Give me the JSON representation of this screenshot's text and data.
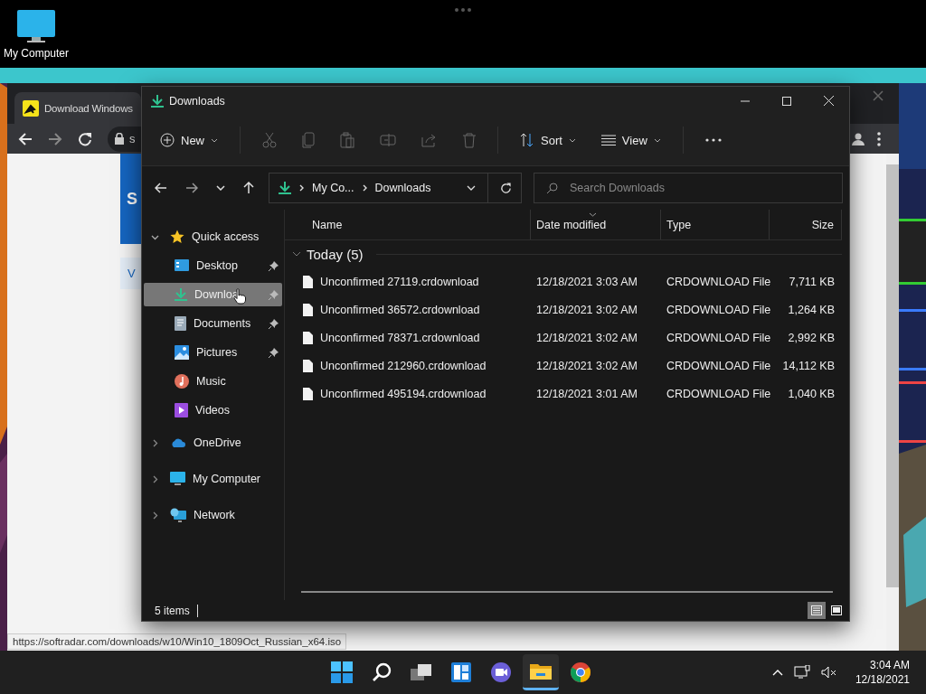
{
  "desktop": {
    "icons": [
      {
        "label": "My Computer"
      }
    ]
  },
  "browser": {
    "tab_title": "Download Windows",
    "address_text": "s",
    "page_fragments": [
      "S",
      "V"
    ],
    "status_link": "https://softradar.com/downloads/w10/Win10_1809Oct_Russian_x64.iso"
  },
  "explorer": {
    "title": "Downloads",
    "commands": [
      {
        "label": "New"
      },
      {
        "label": "Sort"
      },
      {
        "label": "View"
      }
    ],
    "breadcrumb": [
      "My Co...",
      "Downloads"
    ],
    "search": {
      "placeholder": "Search Downloads"
    },
    "nav": [
      {
        "label": "Quick access",
        "expanded": true,
        "children": [
          {
            "label": "Desktop",
            "pinned": true,
            "selected": false
          },
          {
            "label": "Downloa",
            "pinned": true,
            "selected": true
          },
          {
            "label": "Documents",
            "pinned": true,
            "selected": false
          },
          {
            "label": "Pictures",
            "pinned": true,
            "selected": false
          },
          {
            "label": "Music",
            "pinned": false,
            "selected": false
          },
          {
            "label": "Videos",
            "pinned": false,
            "selected": false
          }
        ]
      },
      {
        "label": "OneDrive",
        "expanded": false
      },
      {
        "label": "My Computer",
        "expanded": false
      },
      {
        "label": "Network",
        "expanded": false
      }
    ],
    "columns": [
      {
        "label": "Name",
        "sorted": false
      },
      {
        "label": "Date modified",
        "sorted": true
      },
      {
        "label": "Type",
        "sorted": false
      },
      {
        "label": "Size",
        "sorted": false
      }
    ],
    "group": {
      "label": "Today (5)",
      "expanded": true
    },
    "rows": [
      {
        "name": "Unconfirmed 27119.crdownload",
        "date": "12/18/2021 3:03 AM",
        "type": "CRDOWNLOAD File",
        "size": "7,711 KB"
      },
      {
        "name": "Unconfirmed 36572.crdownload",
        "date": "12/18/2021 3:02 AM",
        "type": "CRDOWNLOAD File",
        "size": "1,264 KB"
      },
      {
        "name": "Unconfirmed 78371.crdownload",
        "date": "12/18/2021 3:02 AM",
        "type": "CRDOWNLOAD File",
        "size": "2,992 KB"
      },
      {
        "name": "Unconfirmed 212960.crdownload",
        "date": "12/18/2021 3:02 AM",
        "type": "CRDOWNLOAD File",
        "size": "14,112 KB"
      },
      {
        "name": "Unconfirmed 495194.crdownload",
        "date": "12/18/2021 3:01 AM",
        "type": "CRDOWNLOAD File",
        "size": "1,040 KB"
      }
    ],
    "status": "5 items",
    "views": [
      {
        "selected": true
      },
      {
        "selected": false
      }
    ]
  },
  "taskbar": {
    "apps": [
      {
        "selected": false
      },
      {
        "selected": false
      },
      {
        "selected": false
      },
      {
        "selected": false
      },
      {
        "selected": true
      },
      {
        "selected": false
      }
    ],
    "time": "3:04 AM",
    "date": "12/18/2021"
  }
}
